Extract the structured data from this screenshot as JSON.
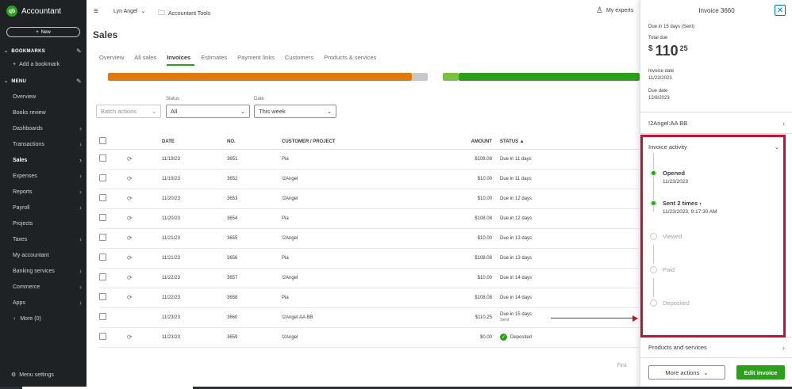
{
  "app": {
    "logo_mark": "qb",
    "logo_text": "Accountant",
    "new_label": "New"
  },
  "sidebar": {
    "bookmarks_title": "BOOKMARKS",
    "add_bookmark": "Add a bookmark",
    "menu_title": "MENU",
    "items": [
      {
        "label": "Overview",
        "chevron": false
      },
      {
        "label": "Books review",
        "chevron": false
      },
      {
        "label": "Dashboards",
        "chevron": true
      },
      {
        "label": "Transactions",
        "chevron": true
      },
      {
        "label": "Sales",
        "chevron": true,
        "active": true
      },
      {
        "label": "Expenses",
        "chevron": true
      },
      {
        "label": "Reports",
        "chevron": true
      },
      {
        "label": "Payroll",
        "chevron": true
      },
      {
        "label": "Projects",
        "chevron": false
      },
      {
        "label": "Taxes",
        "chevron": true
      },
      {
        "label": "My accountant",
        "chevron": false
      },
      {
        "label": "Banking services",
        "chevron": true
      },
      {
        "label": "Commerce",
        "chevron": true
      },
      {
        "label": "Apps",
        "chevron": true
      }
    ],
    "more_label": "More (0)",
    "menu_settings": "Menu settings"
  },
  "topbar": {
    "user_name": "Lyn Angel",
    "tools_label": "Accountant Tools",
    "experts_label": "My experts"
  },
  "page": {
    "title": "Sales",
    "tabs": [
      "Overview",
      "All sales",
      "Invoices",
      "Estimates",
      "Payment links",
      "Customers",
      "Products & services"
    ],
    "active_tab": "Invoices"
  },
  "filters": {
    "batch_actions": "Batch actions",
    "status_label": "Status",
    "status_value": "All",
    "date_label": "Date",
    "date_value": "This week"
  },
  "table": {
    "headers": {
      "date": "DATE",
      "no": "NO.",
      "customer": "CUSTOMER / PROJECT",
      "amount": "AMOUNT",
      "status": "STATUS ▲"
    },
    "rows": [
      {
        "date": "11/19/23",
        "no": "3651",
        "customer": "Pia",
        "amount": "$108.08",
        "status": "Due in 11 days",
        "sub": "",
        "repeat": true
      },
      {
        "date": "11/19/23",
        "no": "3652",
        "customer": "!2Angel",
        "amount": "$10.00",
        "status": "Due in 11 days",
        "sub": "",
        "repeat": true
      },
      {
        "date": "11/20/23",
        "no": "3653",
        "customer": "!2Angel",
        "amount": "$10.00",
        "status": "Due in 12 days",
        "sub": "",
        "repeat": true
      },
      {
        "date": "11/20/23",
        "no": "3654",
        "customer": "Pia",
        "amount": "$108.08",
        "status": "Due in 12 days",
        "sub": "",
        "repeat": true
      },
      {
        "date": "11/21/23",
        "no": "3655",
        "customer": "!2Angel",
        "amount": "$10.00",
        "status": "Due in 13 days",
        "sub": "",
        "repeat": true
      },
      {
        "date": "11/21/23",
        "no": "3656",
        "customer": "Pia",
        "amount": "$108.08",
        "status": "Due in 13 days",
        "sub": "",
        "repeat": true
      },
      {
        "date": "11/22/23",
        "no": "3657",
        "customer": "!2Angel",
        "amount": "$10.00",
        "status": "Due in 14 days",
        "sub": "",
        "repeat": true
      },
      {
        "date": "11/22/23",
        "no": "3658",
        "customer": "Pia",
        "amount": "$108.08",
        "status": "Due in 14 days",
        "sub": "",
        "repeat": true
      },
      {
        "date": "11/23/23",
        "no": "3660",
        "customer": "!2Angel:AA BB",
        "amount": "$110.25",
        "status": "Due in 15 days",
        "sub": "Sent",
        "repeat": false
      },
      {
        "date": "11/23/23",
        "no": "3659",
        "customer": "!2Angel",
        "amount": "$0.00",
        "status": "Deposited",
        "sub": "",
        "repeat": true,
        "paid": true
      }
    ],
    "first_label": "First"
  },
  "panel": {
    "title": "Invoice 3660",
    "due_status": "Due in 15 days (Sent)",
    "total_due_label": "Total due",
    "currency": "$",
    "amount_whole": "110",
    "amount_cents": "25",
    "invoice_date_label": "Invoice date",
    "invoice_date": "11/23/2023",
    "due_date_label": "Due date",
    "due_date": "12/8/2023",
    "customer": "!2Angel:AA BB",
    "activity_title": "Invoice activity",
    "steps": [
      {
        "label": "Opened",
        "sub": "11/23/2023",
        "done": true
      },
      {
        "label": "Sent 2 times",
        "sub": "11/23/2023, 9:17:30 AM",
        "done": true
      },
      {
        "label": "Viewed",
        "sub": "",
        "done": false
      },
      {
        "label": "Paid",
        "sub": "",
        "done": false
      },
      {
        "label": "Deposited",
        "sub": "",
        "done": false
      }
    ],
    "products_label": "Products and services",
    "more_actions": "More actions",
    "edit_invoice": "Edit invoice"
  },
  "colors": {
    "brand_green": "#2ca01c",
    "overdue_orange": "#e07a10",
    "highlight_red": "#c8102e",
    "link_blue": "#0077c5"
  }
}
